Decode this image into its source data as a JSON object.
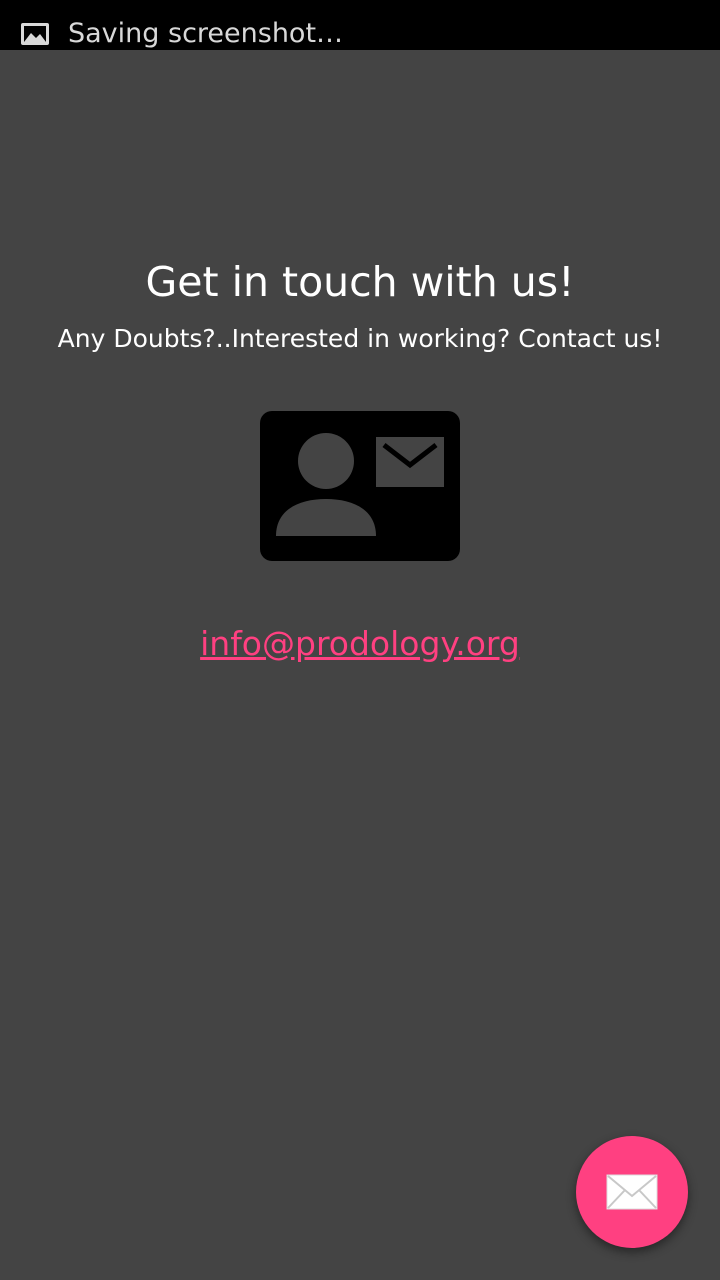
{
  "status_bar": {
    "notification_text": "Saving screenshot…",
    "icon": "image-icon"
  },
  "main": {
    "title": "Get in touch with us!",
    "subtitle": "Any Doubts?..Interested in working? Contact us!",
    "contact_icon": "contact-mail-icon",
    "email": "info@prodology.org"
  },
  "fab": {
    "icon": "envelope-icon",
    "color": "#ff4081"
  },
  "colors": {
    "background": "#444444",
    "accent": "#ff4081",
    "status_bar": "#000000"
  }
}
